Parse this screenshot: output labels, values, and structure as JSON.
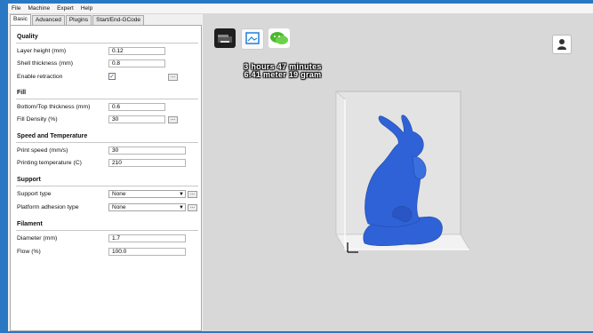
{
  "menu": [
    "File",
    "Machine",
    "Expert",
    "Help"
  ],
  "tabs": [
    "Basic",
    "Advanced",
    "Plugins",
    "Start/End-GCode"
  ],
  "quality": {
    "title": "Quality",
    "layer_height_label": "Layer height (mm)",
    "layer_height_value": "0.12",
    "shell_thickness_label": "Shell thickness (mm)",
    "shell_thickness_value": "0.8",
    "enable_retraction_label": "Enable retraction",
    "enable_retraction_checked": "✓"
  },
  "fill": {
    "title": "Fill",
    "bottom_top_label": "Bottom/Top thickness (mm)",
    "bottom_top_value": "0.6",
    "density_label": "Fill Density (%)",
    "density_value": "30"
  },
  "speed": {
    "title": "Speed and Temperature",
    "print_speed_label": "Print speed (mm/s)",
    "print_speed_value": "30",
    "temp_label": "Printing temperature (C)",
    "temp_value": "210"
  },
  "support": {
    "title": "Support",
    "type_label": "Support type",
    "type_value": "None",
    "adhesion_label": "Platform adhesion type",
    "adhesion_value": "None"
  },
  "filament": {
    "title": "Filament",
    "diameter_label": "Diameter (mm)",
    "diameter_value": "1.7",
    "flow_label": "Flow (%)",
    "flow_value": "100.0"
  },
  "buttons": {
    "dots": "..."
  },
  "estimate": {
    "time": "3 hours 47 minutes",
    "material": "6.41 meter 19 gram"
  },
  "colors": {
    "model": "#2f62d6",
    "accent": "#2a78c4"
  }
}
